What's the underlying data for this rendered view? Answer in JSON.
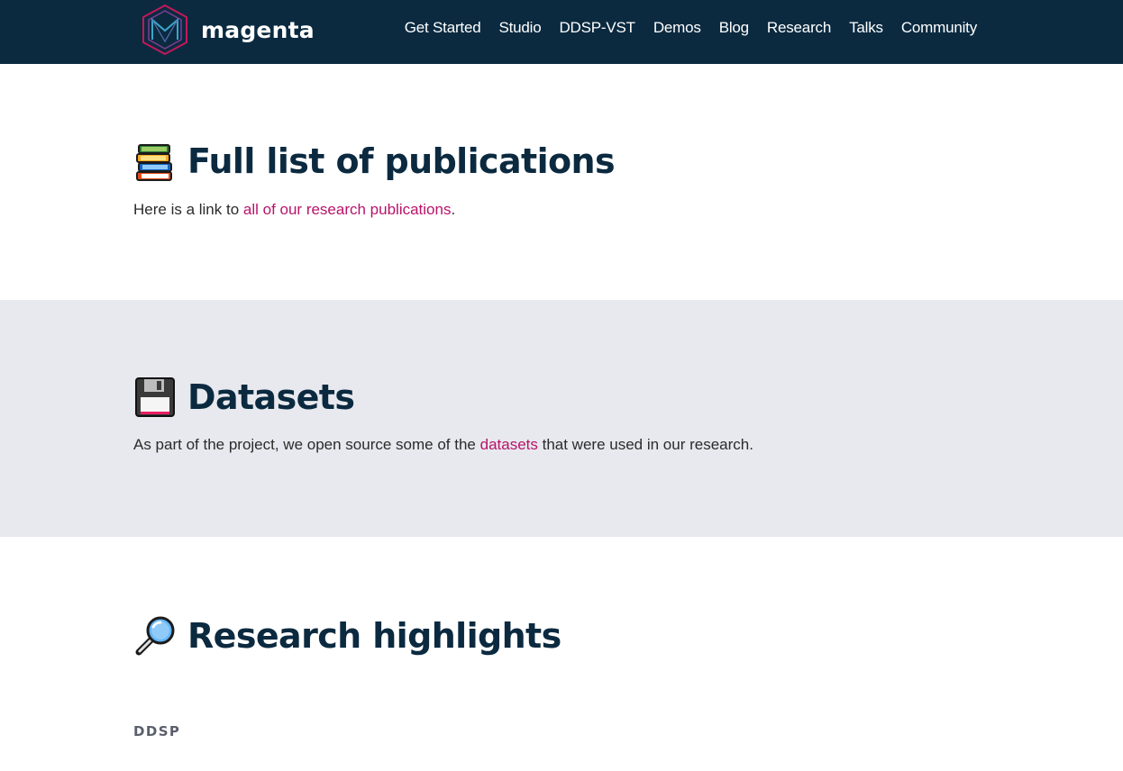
{
  "brand": {
    "name": "magenta"
  },
  "nav": {
    "items": [
      {
        "label": "Get Started"
      },
      {
        "label": "Studio"
      },
      {
        "label": "DDSP-VST"
      },
      {
        "label": "Demos"
      },
      {
        "label": "Blog"
      },
      {
        "label": "Research"
      },
      {
        "label": "Talks"
      },
      {
        "label": "Community"
      }
    ]
  },
  "publications": {
    "emoji_icon": "books-icon",
    "title": "Full list of publications",
    "text_prefix": "Here is a link to ",
    "link_text": "all of our research publications",
    "text_suffix": "."
  },
  "datasets": {
    "emoji_icon": "floppy-disk-icon",
    "title": "Datasets",
    "text_prefix": "As part of the project, we open source some of the ",
    "link_text": "datasets",
    "text_suffix": " that were used in our research."
  },
  "highlights": {
    "emoji_icon": "magnifying-glass-icon",
    "title": "Research highlights",
    "first_item_label": "DDSP"
  },
  "colors": {
    "header_bg": "#0b2a40",
    "link": "#b8136a",
    "alt_section_bg": "#e8e9ee",
    "heading": "#0b2a40"
  }
}
